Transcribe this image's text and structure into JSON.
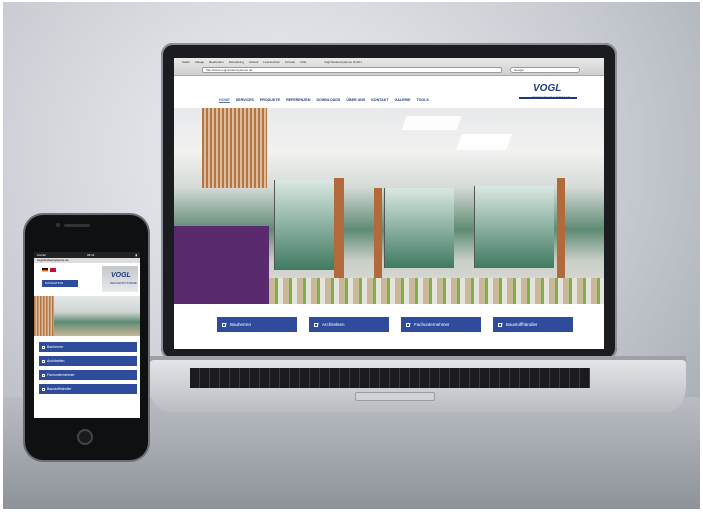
{
  "browser": {
    "menu": [
      "Safari",
      "Ablage",
      "Bearbeiten",
      "Darstellung",
      "Verlauf",
      "Lesezeichen",
      "Fenster",
      "Hilfe"
    ],
    "window_title": "Vogl Deckensysteme GmbH",
    "address": "http://www.vogl-deckensysteme.de",
    "search_placeholder": "Google"
  },
  "site": {
    "logo_main": "VOGL",
    "logo_sub": "DECKENSYSTEME",
    "nav": [
      "HOME",
      "SERVICES",
      "PRODUKTE",
      "REFERENZEN",
      "DOWNLOADS",
      "ÜBER UNS",
      "KONTAKT",
      "GALERIE",
      "TOOLS"
    ],
    "cta": [
      "Bauherren",
      "Architekten",
      "Fachunternehmer",
      "Baustoffhändler"
    ]
  },
  "phone": {
    "carrier": "Carrier",
    "time": "09:41",
    "address": "vogl-deckensysteme.de",
    "menu_button": "NAVIGATION",
    "logo_main": "VOGL",
    "logo_sub": "DECKENSYSTEME",
    "items": [
      "Bauherren",
      "Architekten",
      "Fachunternehmer",
      "Baustoffhändler"
    ]
  },
  "colors": {
    "brand": "#2f4b9c",
    "accent": "#1f3a7a"
  }
}
